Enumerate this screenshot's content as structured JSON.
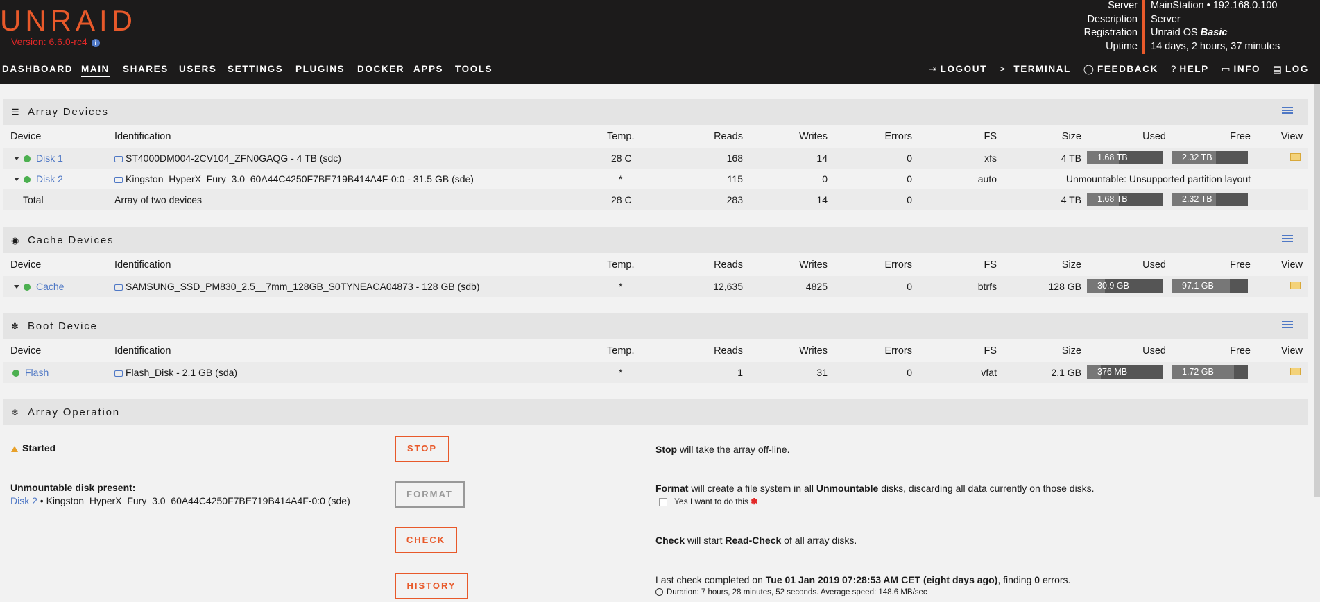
{
  "header": {
    "logo": "UNRAID",
    "version": "Version: 6.6.0-rc4",
    "server_info": [
      {
        "key": "Server",
        "value": "MainStation • 192.168.0.100"
      },
      {
        "key": "Description",
        "value": "Server"
      },
      {
        "key": "Registration",
        "value": "Unraid OS Basic"
      },
      {
        "key": "Uptime",
        "value": "14 days, 2 hours, 37 minutes"
      }
    ]
  },
  "nav": {
    "left": [
      "DASHBOARD",
      "MAIN",
      "SHARES",
      "USERS",
      "SETTINGS",
      "PLUGINS",
      "DOCKER",
      "APPS",
      "TOOLS"
    ],
    "active": "MAIN",
    "right": [
      {
        "icon": "logout-icon",
        "glyph": "⇥",
        "label": "LOGOUT"
      },
      {
        "icon": "terminal-icon",
        "glyph": ">_",
        "label": "TERMINAL"
      },
      {
        "icon": "feedback-icon",
        "glyph": "💬",
        "label": "FEEDBACK"
      },
      {
        "icon": "help-icon",
        "glyph": "?",
        "label": "HELP"
      },
      {
        "icon": "info-icon",
        "glyph": "▭",
        "label": "INFO"
      },
      {
        "icon": "log-icon",
        "glyph": "▤",
        "label": "LOG"
      }
    ]
  },
  "columns": [
    "Device",
    "Identification",
    "Temp.",
    "Reads",
    "Writes",
    "Errors",
    "FS",
    "Size",
    "Used",
    "Free",
    "View"
  ],
  "array_devices": {
    "title": "Array Devices",
    "rows": [
      {
        "device": "Disk 1",
        "id": "ST4000DM004-2CV104_ZFN0GAQG - 4 TB (sdc)",
        "temp": "28 C",
        "reads": "168",
        "writes": "14",
        "errors": "0",
        "fs": "xfs",
        "size": "4 TB",
        "used": "1.68 TB",
        "used_frac": 0.42,
        "free": "2.32 TB",
        "free_frac": 0.58
      },
      {
        "device": "Disk 2",
        "id": "Kingston_HyperX_Fury_3.0_60A44C4250F7BE719B414A4F-0:0 - 31.5 GB (sde)",
        "temp": "*",
        "reads": "115",
        "writes": "0",
        "errors": "0",
        "fs": "auto",
        "status": "Unmountable: Unsupported partition layout"
      }
    ],
    "total": {
      "device": "Total",
      "id": "Array of two devices",
      "temp": "28 C",
      "reads": "283",
      "writes": "14",
      "errors": "0",
      "size": "4 TB",
      "used": "1.68 TB",
      "used_frac": 0.42,
      "free": "2.32 TB",
      "free_frac": 0.58
    }
  },
  "cache_devices": {
    "title": "Cache Devices",
    "rows": [
      {
        "device": "Cache",
        "id": "SAMSUNG_SSD_PM830_2.5__7mm_128GB_S0TYNEACA04873 - 128 GB (sdb)",
        "temp": "*",
        "reads": "12,635",
        "writes": "4825",
        "errors": "0",
        "fs": "btrfs",
        "size": "128 GB",
        "used": "30.9 GB",
        "used_frac": 0.24,
        "free": "97.1 GB",
        "free_frac": 0.76
      }
    ]
  },
  "boot_device": {
    "title": "Boot Device",
    "rows": [
      {
        "device": "Flash",
        "id": "Flash_Disk - 2.1 GB (sda)",
        "temp": "*",
        "reads": "1",
        "writes": "31",
        "errors": "0",
        "fs": "vfat",
        "size": "2.1 GB",
        "used": "376 MB",
        "used_frac": 0.18,
        "free": "1.72 GB",
        "free_frac": 0.82
      }
    ]
  },
  "array_operation": {
    "title": "Array Operation",
    "status": "Started",
    "unmountable_label": "Unmountable disk present:",
    "unmountable_disk": "Disk 2",
    "unmountable_desc": "• Kingston_HyperX_Fury_3.0_60A44C4250F7BE719B414A4F-0:0 (sde)",
    "buttons": {
      "stop": "STOP",
      "format": "FORMAT",
      "check": "CHECK",
      "history": "HISTORY"
    },
    "stop_bold": "Stop",
    "stop_text": " will take the array off-line.",
    "format_bold": "Format",
    "format_text1": " will create a file system in all ",
    "format_bold2": "Unmountable",
    "format_text2": " disks, discarding all data currently on those disks.",
    "confirm_label": "Yes I want to do this",
    "check_bold": "Check",
    "check_text1": " will start ",
    "check_bold2": "Read-Check",
    "check_text2": " of all array disks.",
    "history_text1": "Last check completed on ",
    "history_date": "Tue 01 Jan 2019 07:28:53 AM CET (eight days ago)",
    "history_text2": ", finding ",
    "history_errors": "0",
    "history_text3": " errors.",
    "duration": "Duration: 7 hours, 28 minutes, 52 seconds. Average speed: 148.6 MB/sec"
  }
}
